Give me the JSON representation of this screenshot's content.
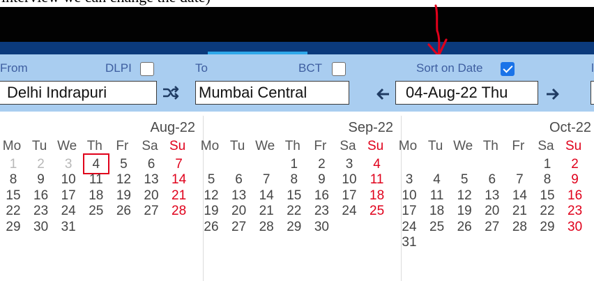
{
  "caption": "interview we can change the date)",
  "search": {
    "from_label": "From",
    "dlpi_label": "DLPI",
    "dlpi_checked": false,
    "to_label": "To",
    "bct_label": "BCT",
    "bct_checked": false,
    "sort_label": "Sort on Date",
    "sort_checked": true,
    "from_value": "Delhi Indrapuri",
    "to_value": "Mumbai Central",
    "date_value": "04-Aug-22 Thu"
  },
  "calendars": [
    {
      "title": "Aug-22",
      "weekdays": [
        "Mo",
        "Tu",
        "We",
        "Th",
        "Fr",
        "Sa",
        "Su"
      ],
      "weeks": [
        [
          "1",
          "2",
          "3",
          "4",
          "5",
          "6",
          "7"
        ],
        [
          "8",
          "9",
          "10",
          "11",
          "12",
          "13",
          "14"
        ],
        [
          "15",
          "16",
          "17",
          "18",
          "19",
          "20",
          "21"
        ],
        [
          "22",
          "23",
          "24",
          "25",
          "26",
          "27",
          "28"
        ],
        [
          "29",
          "30",
          "31",
          "",
          "",
          "",
          ""
        ]
      ],
      "past_days": [
        "1",
        "2",
        "3"
      ],
      "selected_day": "4"
    },
    {
      "title": "Sep-22",
      "weekdays": [
        "Mo",
        "Tu",
        "We",
        "Th",
        "Fr",
        "Sa",
        "Su"
      ],
      "weeks": [
        [
          "",
          "",
          "",
          "1",
          "2",
          "3",
          "4"
        ],
        [
          "5",
          "6",
          "7",
          "8",
          "9",
          "10",
          "11"
        ],
        [
          "12",
          "13",
          "14",
          "15",
          "16",
          "17",
          "18"
        ],
        [
          "19",
          "20",
          "21",
          "22",
          "23",
          "24",
          "25"
        ],
        [
          "26",
          "27",
          "28",
          "29",
          "30",
          "",
          ""
        ]
      ],
      "past_days": [],
      "selected_day": ""
    },
    {
      "title": "Oct-22",
      "weekdays": [
        "Mo",
        "Tu",
        "We",
        "Th",
        "Fr",
        "Sa",
        "Su"
      ],
      "weeks": [
        [
          "",
          "",
          "",
          "",
          "",
          "1",
          "2"
        ],
        [
          "3",
          "4",
          "5",
          "6",
          "7",
          "8",
          "9"
        ],
        [
          "10",
          "11",
          "12",
          "13",
          "14",
          "15",
          "16"
        ],
        [
          "17",
          "18",
          "19",
          "20",
          "21",
          "22",
          "23"
        ],
        [
          "24",
          "25",
          "26",
          "27",
          "28",
          "29",
          "30"
        ],
        [
          "31",
          "",
          "",
          "",
          "",
          "",
          ""
        ]
      ],
      "past_days": [],
      "selected_day": ""
    }
  ],
  "colors": {
    "sunday": "#e0001b",
    "panel": "#a9cdf0",
    "nav_band": "#0b3a7c",
    "active_tab": "#2ea8ea",
    "annotation": "#e0001b"
  },
  "icons": [
    "swap-stations-icon",
    "prev-date-arrow-icon",
    "next-date-arrow-icon",
    "annotation-arrow-icon",
    "selected-date-highlight"
  ]
}
